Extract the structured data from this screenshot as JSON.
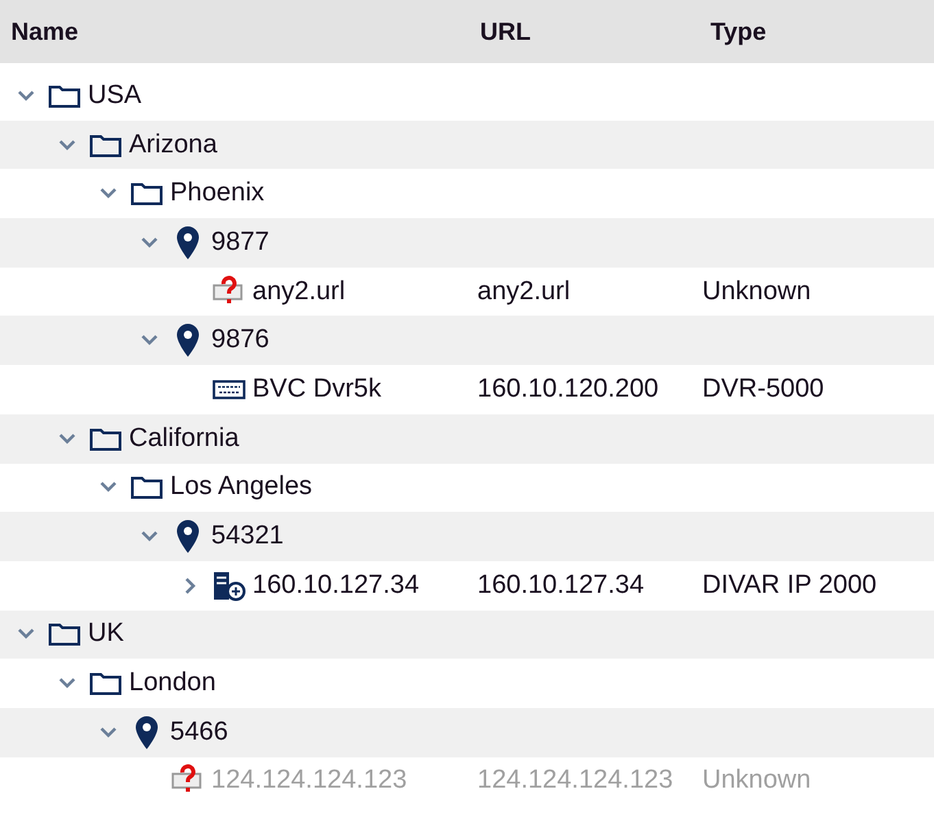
{
  "columns": [
    {
      "label": "Name"
    },
    {
      "label": "URL"
    },
    {
      "label": "Type"
    }
  ],
  "tree": [
    {
      "kind": "folder",
      "name": "USA",
      "expanded": true,
      "children": [
        {
          "kind": "folder",
          "name": "Arizona",
          "expanded": true,
          "children": [
            {
              "kind": "folder",
              "name": "Phoenix",
              "expanded": true,
              "children": [
                {
                  "kind": "location",
                  "name": "9877",
                  "expanded": true,
                  "children": [
                    {
                      "kind": "unknown",
                      "name": "any2.url",
                      "url": "any2.url",
                      "type": "Unknown",
                      "disabled": false
                    }
                  ]
                },
                {
                  "kind": "location",
                  "name": "9876",
                  "expanded": true,
                  "children": [
                    {
                      "kind": "dvr",
                      "name": "BVC Dvr5k",
                      "url": "160.10.120.200",
                      "type": "DVR-5000",
                      "disabled": false
                    }
                  ]
                }
              ]
            }
          ]
        },
        {
          "kind": "folder",
          "name": "California",
          "expanded": true,
          "children": [
            {
              "kind": "folder",
              "name": "Los Angeles",
              "expanded": true,
              "children": [
                {
                  "kind": "location",
                  "name": "54321",
                  "expanded": true,
                  "children": [
                    {
                      "kind": "server",
                      "name": "160.10.127.34",
                      "url": "160.10.127.34",
                      "type": "DIVAR IP 2000",
                      "expanded": false,
                      "disabled": false
                    }
                  ]
                }
              ]
            }
          ]
        }
      ]
    },
    {
      "kind": "folder",
      "name": "UK",
      "expanded": true,
      "children": [
        {
          "kind": "folder",
          "name": "London",
          "expanded": true,
          "children": [
            {
              "kind": "location",
              "name": "5466",
              "expanded": true,
              "children": [
                {
                  "kind": "unknown",
                  "name": "124.124.124.123",
                  "url": "124.124.124.123",
                  "type": "Unknown",
                  "disabled": true
                }
              ]
            }
          ]
        }
      ]
    }
  ]
}
